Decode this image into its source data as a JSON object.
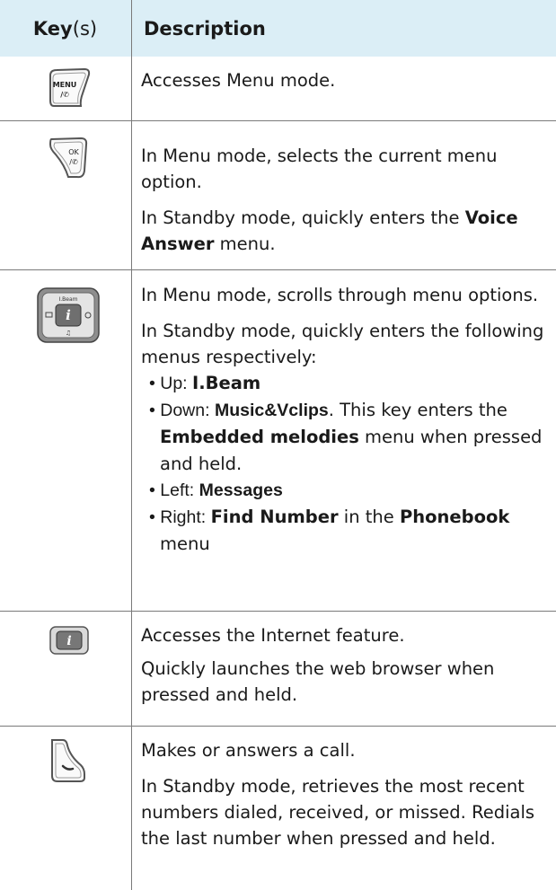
{
  "header": {
    "key_label": "Key",
    "key_suffix": "(s)",
    "desc_label": "Description"
  },
  "rows": [
    {
      "icon": "menu-key-icon",
      "icon_text": [
        "MENU",
        "/✆"
      ],
      "p": [
        "Accesses Menu mode."
      ]
    },
    {
      "icon": "ok-key-icon",
      "icon_text": [
        "OK",
        "/✆"
      ],
      "p": [
        "In Menu mode, selects the current menu option."
      ],
      "p2": {
        "pre": "In Standby mode, quickly enters the ",
        "bold": "Voice Answer",
        "post": " menu."
      }
    },
    {
      "icon": "navigation-key-icon",
      "icon_text": [
        "I.Beam",
        "i",
        "♫"
      ],
      "p": [
        "In Menu mode, scrolls through menu options.",
        "In Standby mode, quickly enters the following menus respectively:"
      ],
      "bullets": [
        {
          "pre": "Up: ",
          "bold": "I.Beam",
          "post": ""
        },
        {
          "pre": "Down: ",
          "bold": "Music&Vclips",
          "post": ". This key enters the ",
          "bold2": "Embedded melodies",
          "post2": " menu when pressed and held."
        },
        {
          "pre": "Left: ",
          "bold": "Messages",
          "post": ""
        },
        {
          "pre": "Right: ",
          "bold": "Find Number",
          "post": " in the ",
          "bold2": "Phonebook",
          "post2": " menu"
        }
      ]
    },
    {
      "icon": "internet-key-icon",
      "icon_text": [
        "i"
      ],
      "p": [
        "Accesses the Internet feature.",
        "Quickly launches the web browser when pressed and held."
      ]
    },
    {
      "icon": "call-key-icon",
      "p": [
        "Makes or answers a call.",
        "In Standby mode, retrieves the most recent numbers dialed, received, or missed. Redials the last number when pressed and held."
      ]
    }
  ]
}
